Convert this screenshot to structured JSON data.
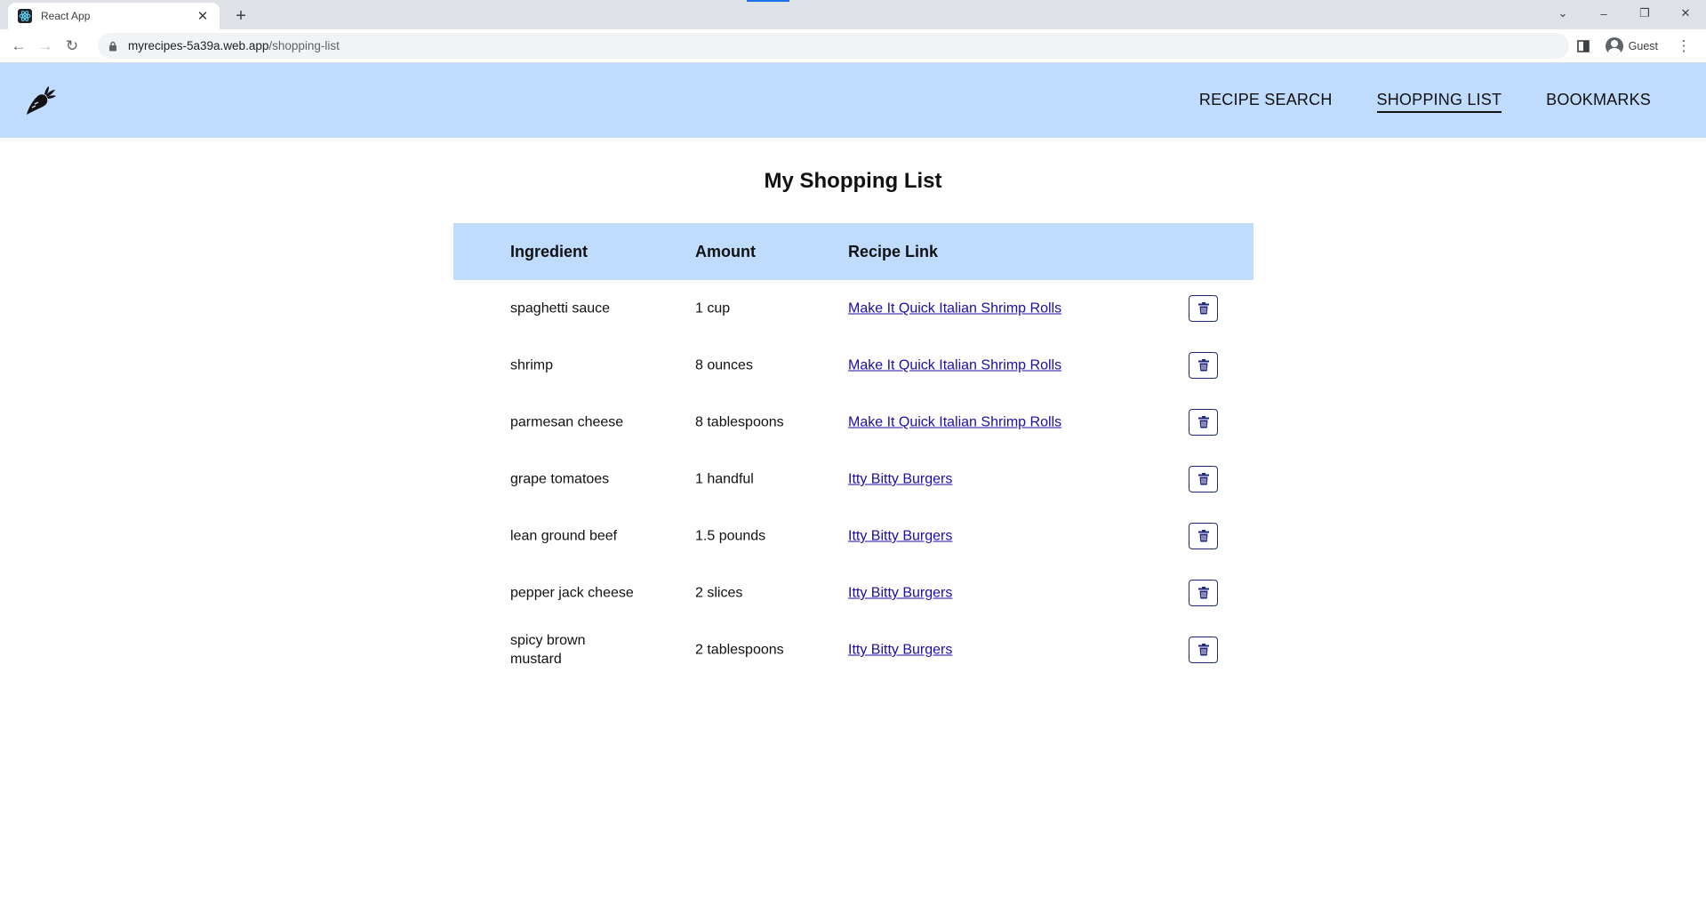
{
  "browser": {
    "tab_title": "React App",
    "tab_close": "✕",
    "new_tab": "+",
    "url_host": "myrecipes-5a39a.web.app",
    "url_path": "/shopping-list",
    "profile_label": "Guest",
    "icons": {
      "back": "←",
      "forward": "→",
      "reload": "↻",
      "tab_list": "⌄",
      "minimize": "–",
      "restore": "❐",
      "close": "✕",
      "menu": "⋮"
    }
  },
  "header": {
    "nav": [
      {
        "label": "RECIPE SEARCH",
        "active": false
      },
      {
        "label": "SHOPPING LIST",
        "active": true
      },
      {
        "label": "BOOKMARKS",
        "active": false
      }
    ],
    "background": "#bfdbfe"
  },
  "main": {
    "title": "My Shopping List",
    "columns": {
      "ingredient": "Ingredient",
      "amount": "Amount",
      "recipe_link": "Recipe Link"
    },
    "rows": [
      {
        "ingredient": "spaghetti sauce",
        "amount": "1 cup",
        "recipe": "Make It Quick Italian Shrimp Rolls"
      },
      {
        "ingredient": "shrimp",
        "amount": "8 ounces",
        "recipe": "Make It Quick Italian Shrimp Rolls"
      },
      {
        "ingredient": "parmesan cheese",
        "amount": "8 tablespoons",
        "recipe": "Make It Quick Italian Shrimp Rolls"
      },
      {
        "ingredient": "grape tomatoes",
        "amount": "1 handful",
        "recipe": "Itty Bitty Burgers"
      },
      {
        "ingredient": "lean ground beef",
        "amount": "1.5 pounds",
        "recipe": "Itty Bitty Burgers"
      },
      {
        "ingredient": "pepper jack cheese",
        "amount": "2 slices",
        "recipe": "Itty Bitty Burgers"
      },
      {
        "ingredient": "spicy brown mustard",
        "amount": "2 tablespoons",
        "recipe": "Itty Bitty Burgers"
      }
    ],
    "delete_icon": "trash-icon",
    "link_color": "#1a0dab",
    "button_border_color": "#1e2a78"
  }
}
